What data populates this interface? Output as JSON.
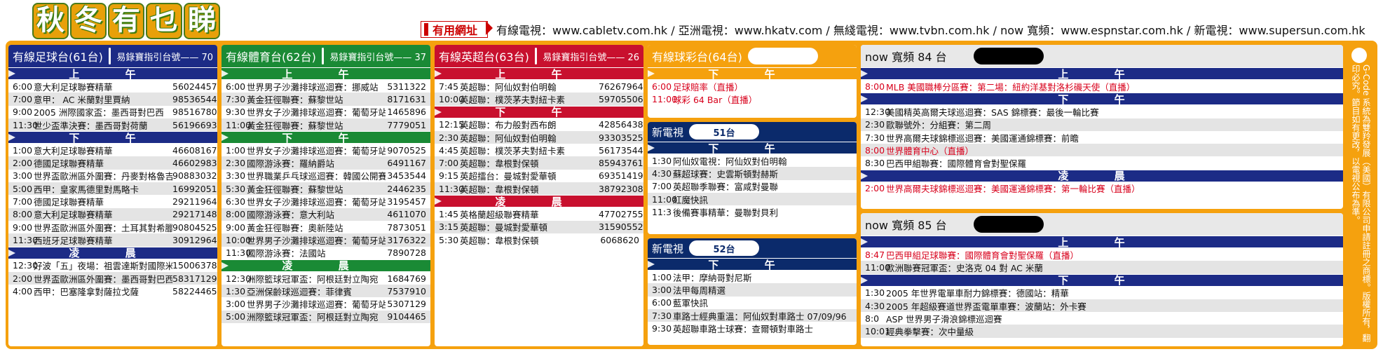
{
  "header": {
    "logo_chars": [
      "秋",
      "冬",
      "有",
      "乜",
      "睇"
    ],
    "useful_label": "有用網址",
    "urls": "有線電視：www.cabletv.com.hk / 亞洲電視：www.hkatv.com / 無綫電視：www.tvbn.com.hk / now 寬頻：www.espnstar.com.hk / 新電視：www.supersun.com.hk"
  },
  "colors": {
    "cable_soccer": "#1c2b86",
    "cable_sports": "#1a8a35",
    "cable_epl": "#c8102e",
    "cable_ball": "#f5a10e",
    "now": "#1c2b86"
  },
  "panels": [
    {
      "title": "有線足球台(61台)",
      "guide": "易錄寶指引台號—— 70",
      "sections": [
        {
          "label": "上 午",
          "rows": [
            [
              "6:00",
              "意大利足球聯賽精華",
              "56024457"
            ],
            [
              "7:00",
              "意甲： AC 米蘭對里賈納",
              "98536544"
            ],
            [
              "9:00",
              "2005 洲際國家盃：墨西哥對巴西",
              "98516780"
            ],
            [
              "11:30",
              "世少盃準決賽：墨西哥對荷蘭",
              "56196693"
            ]
          ]
        },
        {
          "label": "下 午",
          "rows": [
            [
              "1:00",
              "意大利足球聯賽精華",
              "46608167"
            ],
            [
              "2:00",
              "德國足球聯賽精華",
              "46602983"
            ],
            [
              "3:00",
              "世界盃歐洲區外圍賽：丹麥對格魯吉亞",
              "90883032"
            ],
            [
              "5:00",
              "西甲：皇家馬德里對馬略卡",
              "16992051"
            ],
            [
              "7:00",
              "德國足球聯賽精華",
              "29211964"
            ],
            [
              "8:00",
              "意大利足球聯賽精華",
              "29217148"
            ],
            [
              "9:00",
              "世界盃歐洲區外圍賽：土耳其對希臘",
              "90804525"
            ],
            [
              "11:30",
              "西班牙足球聯賽精華",
              "30912964"
            ]
          ]
        },
        {
          "label": "凌 晨",
          "rows": [
            [
              "12:30",
              "好波「五」夜場：祖雲達斯對國際米蘭",
              "15006378"
            ],
            [
              "2:00",
              "世界盃歐洲區外圍賽：墨西哥對巴西",
              "58317129"
            ],
            [
              "4:00",
              "西甲：巴塞隆拿對薩拉戈薩",
              "58224465"
            ]
          ]
        }
      ]
    },
    {
      "title": "有線體育台(62台)",
      "guide": "易錄寶指引台號—— 37",
      "sections": [
        {
          "label": "上 午",
          "rows": [
            [
              "6:00",
              "世界男子沙灘排球巡迴賽：挪威站",
              "5311322"
            ],
            [
              "7:30",
              "黃金狂徑聯賽：蘇黎世站",
              "8171631"
            ],
            [
              "9:30",
              "世界女子沙灘排球巡迴賽：葡萄牙站",
              "1465896"
            ],
            [
              "11:00",
              "黃金狂徑聯賽：蘇黎世站",
              "7779051"
            ]
          ]
        },
        {
          "label": "下 午",
          "rows": [
            [
              "1:00",
              "世界女子沙灘排球巡迴賽：葡萄牙站",
              "9070525"
            ],
            [
              "2:30",
              "國際游泳賽：羅納爵站",
              "6491167"
            ],
            [
              "3:30",
              "世界職業乒乓球巡迴賽：韓國公開賽",
              "3453544"
            ],
            [
              "5:30",
              "黃金狂徑聯賽：蘇黎世站",
              "2446235"
            ],
            [
              "6:30",
              "世界女子沙灘排球巡迴賽：葡萄牙站",
              "3195457"
            ],
            [
              "8:00",
              "國際游泳賽：意大利站",
              "4611070"
            ],
            [
              "9:00",
              "黃金狂徑聯賽：奧新陸站",
              "7873051"
            ],
            [
              "10:00",
              "世界男子沙灘排球巡迴賽：葡萄牙站",
              "3176322"
            ],
            [
              "11:30",
              "國際游泳賽：法國站",
              "7890728"
            ]
          ]
        },
        {
          "label": "凌 晨",
          "rows": [
            [
              "12:30",
              "洲際籃球冠軍盃：阿根廷對立陶宛",
              "1684769"
            ],
            [
              "1:30",
              "亞洲保齡球巡迴賽：菲律賓",
              "7537910"
            ],
            [
              "3:00",
              "世界男子沙灘排球巡迴賽：葡萄牙站",
              "5307129"
            ],
            [
              "5:00",
              "洲際籃球冠軍盃：阿根廷對立陶宛",
              "9104465"
            ]
          ]
        }
      ]
    },
    {
      "title": "有線英超台(63台)",
      "guide": "易錄寶指引台號—— 26",
      "sections": [
        {
          "label": "上 午",
          "rows": [
            [
              "7:45",
              "英超聯：阿仙奴對伯明翰",
              "76267964"
            ],
            [
              "10:00",
              "英超聯：樸茨茅夫對紐卡素",
              "59705506"
            ]
          ]
        },
        {
          "label": "下 午",
          "rows": [
            [
              "12:15",
              "英超聯：布力般對西布朗",
              "42856438"
            ],
            [
              "2:30",
              "英超聯：阿仙奴對伯明翰",
              "93303525"
            ],
            [
              "4:45",
              "英超聯：樸茨茅夫對紐卡素",
              "56173544"
            ],
            [
              "7:00",
              "英超聯：韋根對保頓",
              "85943761"
            ],
            [
              "9:15",
              "英超擂台：曼城對愛華頓",
              "69351419"
            ],
            [
              "11:30",
              "英超聯：韋根對保頓",
              "38792308"
            ]
          ]
        },
        {
          "label": "凌 晨",
          "rows": [
            [
              "1:45",
              "英格蘭超級聯賽精華",
              "47702755"
            ],
            [
              "3:15",
              "英超聯：曼城對愛華頓",
              "31590552"
            ],
            [
              "5:30",
              "英超聯：韋根對保頓",
              "6068620"
            ]
          ]
        }
      ]
    }
  ],
  "ball": {
    "title": "有線球彩台(64台)",
    "section": "下 午",
    "rows": [
      [
        "6:00",
        "足球賠率（直播）"
      ],
      [
        "11:00",
        "球彩 64 Bar（直播）"
      ]
    ]
  },
  "nowtv51": {
    "title": "新電視",
    "channel": "51台",
    "section": "下 午",
    "rows": [
      [
        "1:30",
        "阿仙奴電視：阿仙奴對伯明翰"
      ],
      [
        "4:30",
        "蘇超球賽：史雲斯頓對赫斯"
      ],
      [
        "7:00",
        "英超聯季聯賽：富咸對曼聯"
      ],
      [
        "11:00",
        "紅魔快訊"
      ],
      [
        "11:3",
        "後備賽事精華：曼聯對貝利"
      ]
    ]
  },
  "nowtv52": {
    "title": "新電視",
    "channel": "52台",
    "section": "下 午",
    "rows": [
      [
        "1:00",
        "法甲：摩納哥對尼斯"
      ],
      [
        "3:00",
        "法甲每周精選"
      ],
      [
        "6:00",
        "藍軍快訊"
      ],
      [
        "7:30",
        "車路士經典重溫：阿仙奴對車路士 07/09/96"
      ],
      [
        "9:30",
        "英超聯車路士球賽：查爾頓對車路士"
      ]
    ]
  },
  "now84": {
    "title": "now 寬頻 84 台",
    "sections": [
      {
        "label": "上 午",
        "rows": [
          [
            "8:00",
            "MLB 美國職棒分區賽：第二場：紐約洋基對洛杉磯天使（直播）",
            "red"
          ]
        ]
      },
      {
        "label": "下 午",
        "rows": [
          [
            "12:30",
            "美國精英高爾夫球巡迴賽：SAS 錦標賽：最後一輪比賽",
            ""
          ],
          [
            "2:30",
            "歐聯號外：分組賽：第二周",
            ""
          ],
          [
            "7:30",
            "世界高爾夫球錦標巡迴賽：美國運通錦標賽：前瞻",
            ""
          ],
          [
            "8:00",
            "世界體育中心（直播）",
            "red"
          ],
          [
            "8:30",
            "巴西甲組聯賽：國際體育會對聖保羅",
            ""
          ]
        ]
      },
      {
        "label": "凌 晨",
        "rows": [
          [
            "2:00",
            "世界高爾夫球錦標巡迴賽：美國運通錦標賽：第一輪比賽（直播）",
            "red"
          ]
        ]
      }
    ]
  },
  "now85": {
    "title": "now 寬頻 85 台",
    "sections": [
      {
        "label": "上 午",
        "rows": [
          [
            "8:47",
            "巴西甲組足球聯賽：國際體育會對聖保羅（直播）",
            "red"
          ],
          [
            "11:00",
            "歐洲聯賽冠軍盃：史洛克 04 對 AC 米蘭",
            ""
          ]
        ]
      },
      {
        "label": "下 午",
        "rows": [
          [
            "1:30",
            "2005 年世界電單車耐力錦標賽：德國站：精華",
            ""
          ],
          [
            "4:30",
            "2005 年超級賽道世界盃電單車賽：波蘭站：外卡賽",
            ""
          ],
          [
            "8:0",
            "ASP 世界男子滑浪錦標巡迴賽",
            ""
          ],
          [
            "10:01",
            "經典拳擊賽：次中量級",
            ""
          ]
        ]
      }
    ]
  },
  "side": {
    "text": "G-Code 系統為雙羚發展（美國）有限公司申請註冊之商標。版權所有，翻印必究。節目如有更改，以電視公布為準。"
  }
}
